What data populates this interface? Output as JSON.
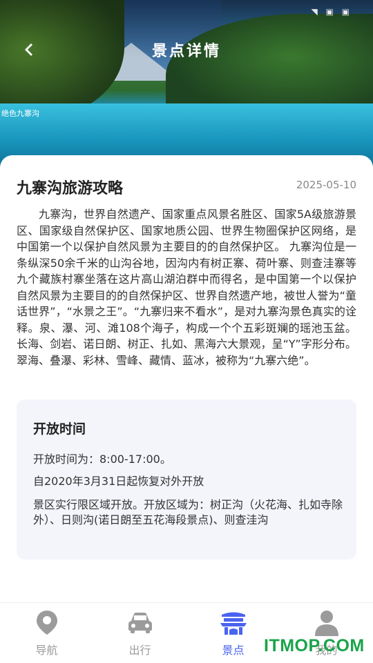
{
  "header": {
    "title": "景点详情",
    "image_caption": "绝色九寨沟",
    "status_icons": "◥ ▣ ▣"
  },
  "article": {
    "title": "九寨沟旅游攻略",
    "date": "2025-05-10",
    "body": "九寨沟，世界自然遗产、国家重点风景名胜区、国家5A级旅游景区、国家级自然保护区、国家地质公园、世界生物圈保护区网络，是中国第一个以保护自然风景为主要目的的自然保护区。 九寨沟位是一条纵深50余千米的山沟谷地，因沟内有树正寨、荷叶寨、则查洼寨等九个藏族村寨坐落在这片高山湖泊群中而得名，是中国第一个以保护自然风景为主要目的的自然保护区、世界自然遗产地，被世人誉为“童话世界”，“水景之王”。“九寨归来不看水”，是对九寨沟景色真实的诠释。泉、瀑、河、滩108个海子，构成一个个五彩斑斓的瑶池玉盆。长海、剑岩、诺日朗、树正、扎如、黑海六大景观，呈“Y”字形分布。翠海、叠瀑、彩林、雪峰、藏情、蓝冰，被称为“九寨六绝”。"
  },
  "open_time": {
    "title": "开放时间",
    "hours": "开放时间为：8:00-17:00。",
    "reopen": "自2020年3月31日起恢复对外开放",
    "area": "景区实行限区域开放。开放区域为：树正沟（火花海、扎如寺除外）、日则沟(诺日朗至五花海段景点)、则查洼沟"
  },
  "tabs": [
    {
      "label": "导航",
      "icon": "location-pin-icon"
    },
    {
      "label": "出行",
      "icon": "car-icon"
    },
    {
      "label": "景点",
      "icon": "pavilion-icon"
    },
    {
      "label": "我的",
      "icon": "user-icon"
    }
  ],
  "active_tab": 2,
  "watermark": "ITMOP.COM",
  "colors": {
    "accent": "#4a63f0",
    "inactive": "#9b9b9b",
    "panel_bg": "#f3f5fb",
    "watermark": "#1aa34a"
  }
}
